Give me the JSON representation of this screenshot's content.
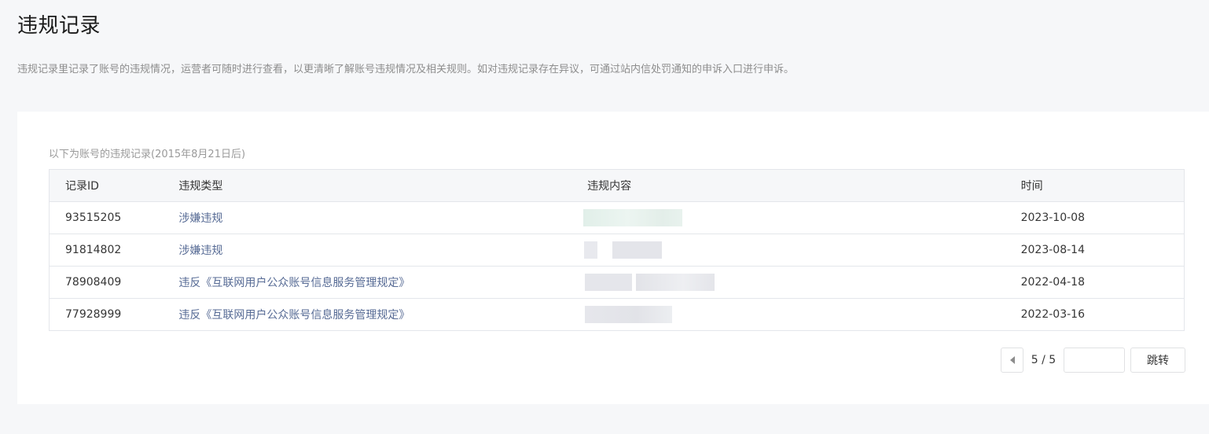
{
  "page": {
    "title": "违规记录",
    "description": "违规记录里记录了账号的违规情况，运营者可随时进行查看，以更清晰了解账号违规情况及相关规则。如对违规记录存在异议，可通过站内信处罚通知的申诉入口进行申诉。"
  },
  "table": {
    "caption": "以下为账号的违规记录(2015年8月21日后)",
    "headers": {
      "id": "记录ID",
      "type": "违规类型",
      "content": "违规内容",
      "time": "时间"
    },
    "rows": [
      {
        "id": "93515205",
        "type": "涉嫌违规",
        "time": "2023-10-08"
      },
      {
        "id": "91814802",
        "type": "涉嫌违规",
        "time": "2023-08-14"
      },
      {
        "id": "78908409",
        "type": "违反《互联网用户公众账号信息服务管理规定》",
        "time": "2022-04-18"
      },
      {
        "id": "77928999",
        "type": "违反《互联网用户公众账号信息服务管理规定》",
        "time": "2022-03-16"
      }
    ]
  },
  "pagination": {
    "page_info": "5 / 5",
    "jump_input_value": "",
    "jump_label": "跳转"
  },
  "colors": {
    "link": "#576b95",
    "background": "#f6f7f9",
    "redacted_green": "#dfeee8",
    "redacted_gray": "#e4e5ea"
  }
}
